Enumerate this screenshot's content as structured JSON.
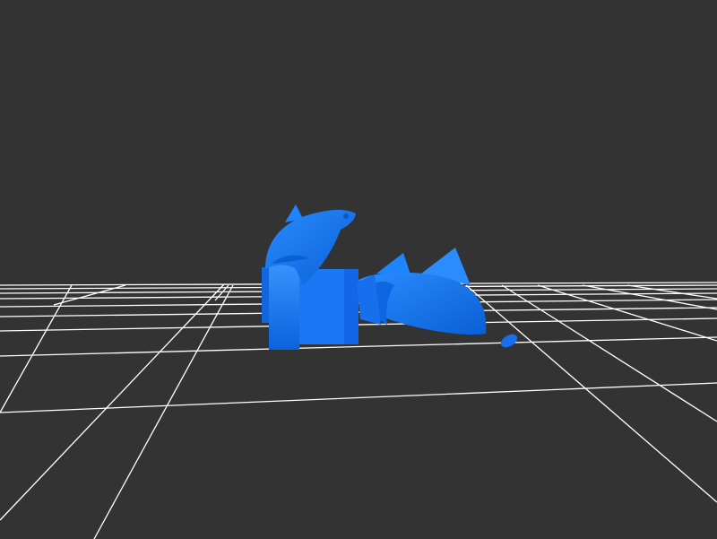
{
  "viewport": {
    "background_color": "#333333",
    "grid_color": "#ffffff",
    "model_color": "#1a7fff"
  },
  "scene": {
    "objects": [
      {
        "name": "fish-model-upright"
      },
      {
        "name": "fish-model-lying"
      },
      {
        "name": "small-fragment"
      }
    ]
  }
}
